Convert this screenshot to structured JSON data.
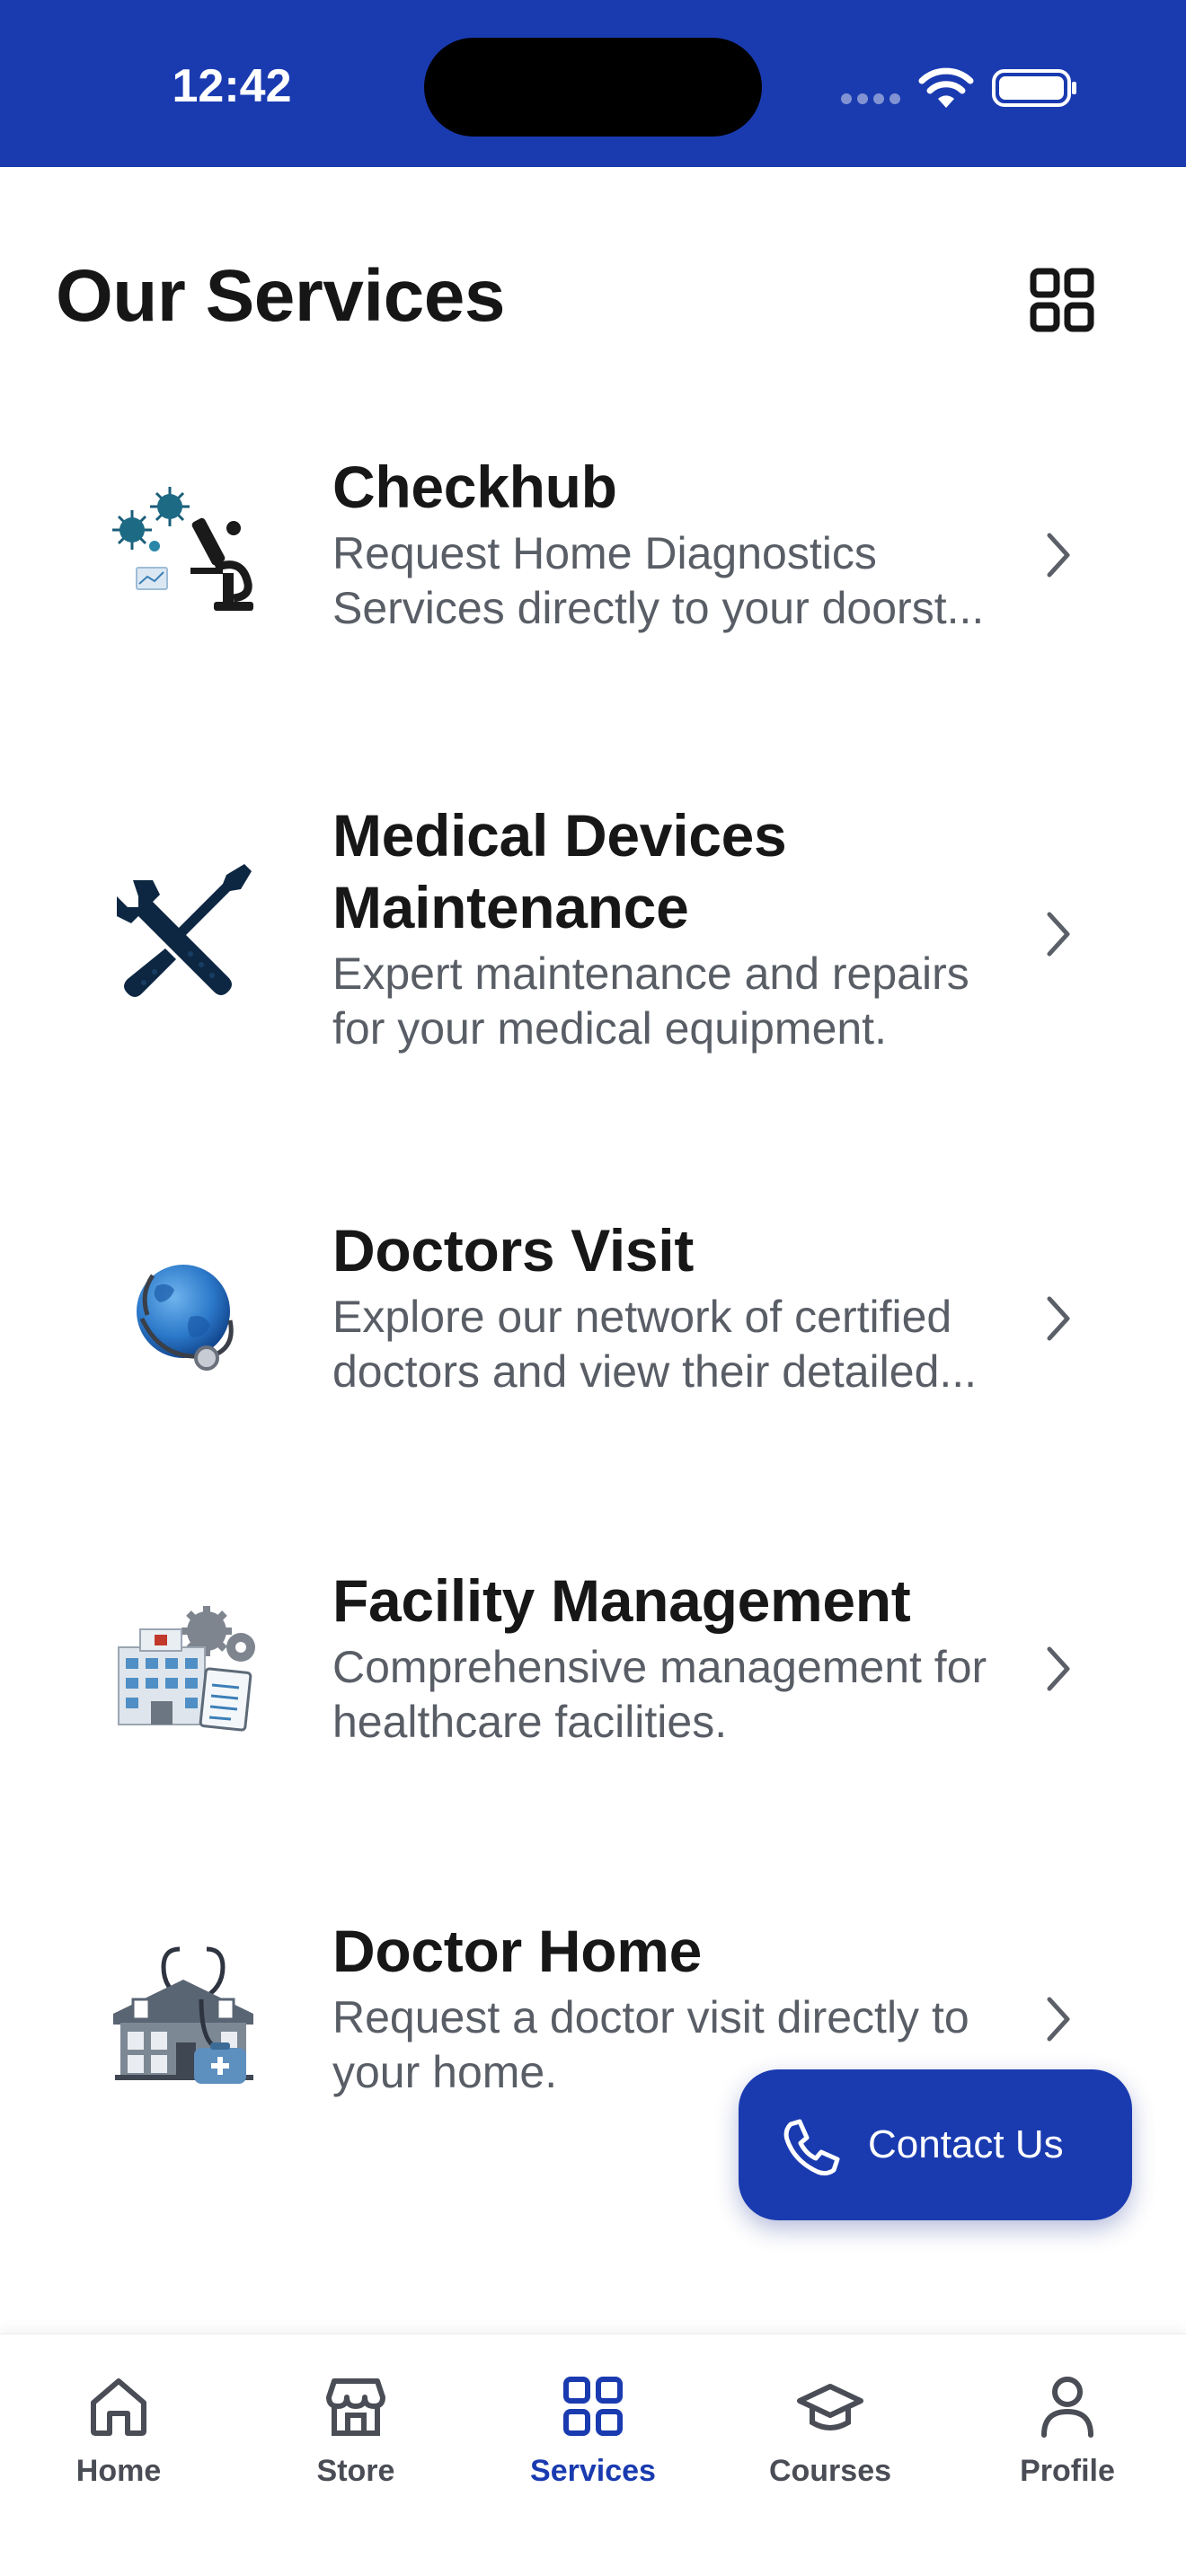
{
  "colors": {
    "brand": "#1a3bb0",
    "title_text": "#171717",
    "body_text": "#595e66",
    "inactive_tab": "#4a4d55"
  },
  "status_bar": {
    "time": "12:42"
  },
  "header": {
    "title": "Our Services",
    "view_toggle_icon": "grid-icon"
  },
  "services": [
    {
      "title": "Checkhub",
      "description": "Request Home Diagnostics Services directly to your doorst...",
      "icon": "microscope-virus-icon"
    },
    {
      "title": "Medical Devices Maintenance",
      "description": "Expert maintenance and repairs for your medical equipment.",
      "icon": "wrench-screwdriver-icon"
    },
    {
      "title": "Doctors Visit",
      "description": "Explore our network of certified doctors and view their detailed...",
      "icon": "globe-stethoscope-icon"
    },
    {
      "title": "Facility Management",
      "description": "Comprehensive management for healthcare facilities.",
      "icon": "hospital-gears-icon"
    },
    {
      "title": "Doctor Home",
      "description": "Request a doctor visit directly to your home.",
      "icon": "house-stethoscope-icon"
    }
  ],
  "contact_button": {
    "label": "Contact Us",
    "icon": "phone-icon"
  },
  "tabs": [
    {
      "label": "Home",
      "icon": "home-icon",
      "active": false
    },
    {
      "label": "Store",
      "icon": "store-icon",
      "active": false
    },
    {
      "label": "Services",
      "icon": "grid-icon",
      "active": true
    },
    {
      "label": "Courses",
      "icon": "graduation-cap-icon",
      "active": false
    },
    {
      "label": "Profile",
      "icon": "person-icon",
      "active": false
    }
  ]
}
